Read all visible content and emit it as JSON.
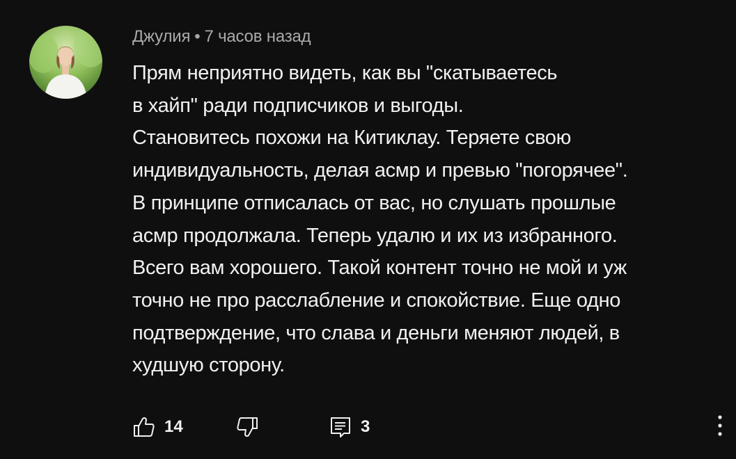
{
  "comment": {
    "author": "Джулия",
    "separator": "•",
    "timestamp": "7 часов назад",
    "text_lines": [
      "Прям неприятно видеть, как вы \"скатываетесь",
      "в хайп\" ради подписчиков и выгоды.",
      "Становитесь похожи на Китиклау. Теряете свою",
      "индивидуальность, делая асмр и превью \"погорячее\".",
      "В принципе отписалась от вас, но слушать прошлые",
      "асмр продолжала. Теперь удалю и их из избранного.",
      "Всего вам хорошего. Такой контент точно не мой и уж",
      "точно не про расслабление и спокойствие. Еще одно",
      "подтверждение, что слава и деньги меняют людей, в",
      "худшую сторону."
    ],
    "likes": "14",
    "replies": "3"
  },
  "icons": {
    "like": "thumb-up-icon",
    "dislike": "thumb-down-icon",
    "replies": "reply-icon",
    "more": "more-vert-icon"
  },
  "colors": {
    "background": "#0f0f0f",
    "text": "#f1f1f1",
    "meta": "#aaaaaa"
  }
}
